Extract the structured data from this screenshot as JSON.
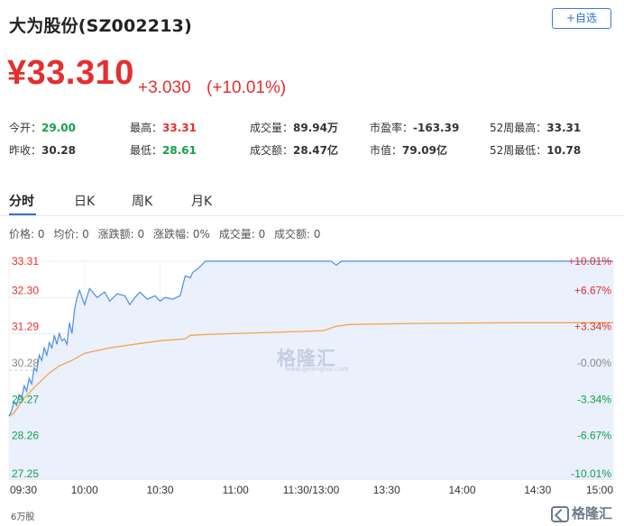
{
  "header": {
    "title": "大为股份(SZ002213)",
    "follow_button": "+自选"
  },
  "quote": {
    "price": "¥33.310",
    "change": "+3.030",
    "change_pct": "(+10.01%)"
  },
  "stats": [
    {
      "label": "今开：",
      "value": "29.00",
      "color": "green"
    },
    {
      "label": "最高：",
      "value": "33.31",
      "color": "red"
    },
    {
      "label": "成交量：",
      "value": "89.94万",
      "color": "dark"
    },
    {
      "label": "市盈率：",
      "value": "-163.39",
      "color": "dark"
    },
    {
      "label": "52周最高：",
      "value": "33.31",
      "color": "dark"
    },
    {
      "label": "昨收：",
      "value": "30.28",
      "color": "dark"
    },
    {
      "label": "最低：",
      "value": "28.61",
      "color": "green"
    },
    {
      "label": "成交额：",
      "value": "28.47亿",
      "color": "dark"
    },
    {
      "label": "市值：",
      "value": "79.09亿",
      "color": "dark"
    },
    {
      "label": "52周最低：",
      "value": "10.78",
      "color": "dark"
    }
  ],
  "tabs": [
    "分时",
    "日K",
    "周K",
    "月K"
  ],
  "info": {
    "price": "价格: 0",
    "avg": "均价: 0",
    "change": "涨跌额: 0",
    "change_pct": "涨跌幅: 0%",
    "volume": "成交量: 0",
    "amount": "成交额: 0"
  },
  "watermark": {
    "text": "格隆汇",
    "sub": "www.gelonghui.com"
  },
  "corner_logo": "格隆汇",
  "colors": {
    "up": "#e62e2e",
    "down": "#14a04a",
    "price_line": "#4a8fe0",
    "avg_line": "#f5a44a",
    "fill": "#eaf0fc",
    "accent": "#2f6fd0"
  },
  "chart_data": {
    "type": "line",
    "x_ticks": [
      "09:30",
      "10:00",
      "10:30",
      "11:00",
      "11:30/13:00",
      "13:30",
      "14:00",
      "14:30",
      "15:00"
    ],
    "y_ticks_left": [
      "33.31",
      "32.30",
      "31.29",
      "30.28",
      "29.27",
      "28.26",
      "27.25"
    ],
    "y_ticks_right": [
      "+10.01%",
      "+6.67%",
      "+3.34%",
      "-0.00%",
      "-3.34%",
      "-6.67%",
      "-10.01%"
    ],
    "ylim": [
      27.25,
      33.31
    ],
    "volume_label": "6万股",
    "series": [
      {
        "key": "price",
        "x": [
          0,
          1,
          2,
          3,
          4,
          5,
          6,
          7,
          8,
          9,
          10,
          11,
          12,
          13,
          14,
          15,
          16,
          17,
          18,
          19,
          20,
          21,
          22,
          23,
          24,
          25,
          26,
          27,
          28,
          30,
          32,
          35,
          38,
          40,
          43,
          46,
          48,
          50,
          52,
          55,
          58,
          60,
          62,
          65,
          68,
          70,
          72,
          73,
          75,
          78,
          80,
          100,
          120,
          128,
          130,
          132,
          150,
          180,
          210,
          240
        ],
        "values": [
          29.0,
          29.15,
          29.4,
          29.3,
          29.6,
          29.5,
          29.85,
          29.7,
          30.05,
          29.9,
          30.35,
          30.25,
          30.7,
          30.55,
          30.9,
          30.7,
          31.05,
          30.9,
          31.25,
          31.0,
          31.3,
          31.1,
          31.15,
          31.0,
          31.6,
          31.3,
          31.95,
          32.3,
          32.5,
          32.1,
          32.55,
          32.3,
          32.45,
          32.2,
          32.4,
          32.35,
          32.1,
          32.3,
          32.45,
          32.25,
          32.35,
          32.2,
          32.3,
          32.25,
          32.35,
          32.9,
          32.85,
          33.0,
          33.1,
          33.31,
          33.31,
          33.31,
          33.31,
          33.31,
          33.2,
          33.31,
          33.31,
          33.31,
          33.31,
          33.31
        ]
      },
      {
        "key": "avg",
        "x": [
          0,
          2,
          4,
          6,
          8,
          10,
          13,
          16,
          20,
          25,
          30,
          40,
          50,
          60,
          70,
          72,
          80,
          100,
          125,
          130,
          135,
          160,
          200,
          240
        ],
        "values": [
          29.0,
          29.1,
          29.3,
          29.5,
          29.65,
          29.8,
          30.0,
          30.2,
          30.4,
          30.55,
          30.75,
          30.9,
          31.0,
          31.1,
          31.15,
          31.25,
          31.28,
          31.32,
          31.38,
          31.5,
          31.55,
          31.58,
          31.6,
          31.6
        ]
      }
    ]
  }
}
